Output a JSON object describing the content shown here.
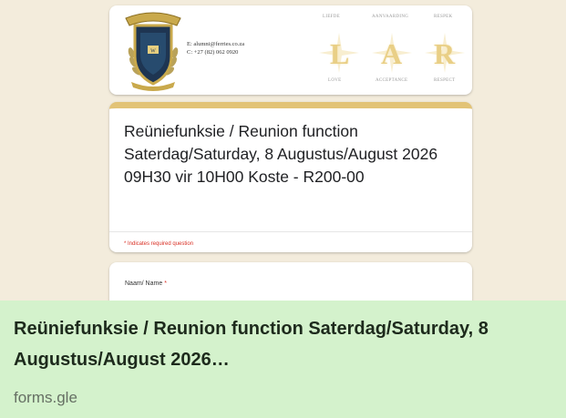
{
  "header": {
    "contact_email": "E: alumni@ferries.co.za",
    "contact_phone": "C: +27 (82) 062 0920",
    "lar_words_top": [
      "LIEFDE",
      "AANVAARDING",
      "RESPEK"
    ],
    "lar_letters": [
      "L",
      "A",
      "R"
    ],
    "lar_words_bottom": [
      "LOVE",
      "ACCEPTANCE",
      "RESPECT"
    ]
  },
  "form": {
    "title": "Reüniefunksie / Reunion function Saterdag/Saturday, 8 Augustus/August 2026 09H30 vir 10H00 Koste - R200-00",
    "required_note": "* Indicates required question",
    "question_label": "Naam/ Name",
    "required_marker": "*"
  },
  "link_preview": {
    "title": "Reüniefunksie / Reunion function Saterdag/Saturday, 8 Augustus/August 2026…",
    "domain": "forms.gle"
  },
  "colors": {
    "page_bg": "#f3ecdc",
    "accent_gold": "#e2c376",
    "required_red": "#d93025",
    "preview_bg": "#d4f2cc"
  }
}
